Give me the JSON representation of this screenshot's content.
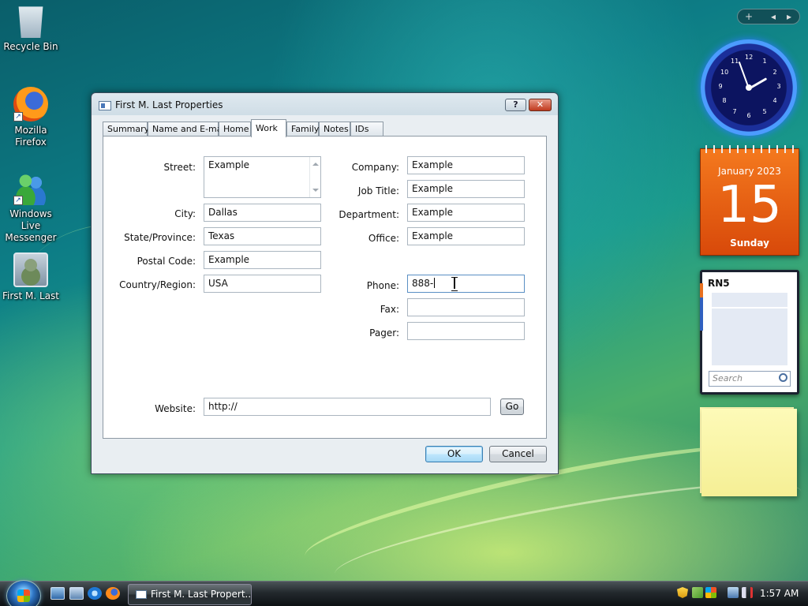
{
  "desktop": {
    "icons": [
      {
        "label": "Recycle Bin"
      },
      {
        "label": "Mozilla Firefox"
      },
      {
        "label": "Windows Live Messenger"
      },
      {
        "label": "First M. Last"
      }
    ]
  },
  "dialog": {
    "title": "First M. Last Properties",
    "help_label": "?",
    "close_label": "✕",
    "tabs": [
      {
        "label": "Summary"
      },
      {
        "label": "Name and E-mail"
      },
      {
        "label": "Home"
      },
      {
        "label": "Work",
        "active": true
      },
      {
        "label": "Family"
      },
      {
        "label": "Notes"
      },
      {
        "label": "IDs"
      }
    ],
    "fields": {
      "street": {
        "label": "Street:",
        "value": "Example"
      },
      "city": {
        "label": "City:",
        "value": "Dallas"
      },
      "state": {
        "label": "State/Province:",
        "value": "Texas"
      },
      "postal": {
        "label": "Postal Code:",
        "value": "Example"
      },
      "country": {
        "label": "Country/Region:",
        "value": "USA"
      },
      "company": {
        "label": "Company:",
        "value": "Example"
      },
      "job_title": {
        "label": "Job Title:",
        "value": "Example"
      },
      "department": {
        "label": "Department:",
        "value": "Example"
      },
      "office": {
        "label": "Office:",
        "value": "Example"
      },
      "phone": {
        "label": "Phone:",
        "value": "888-"
      },
      "fax": {
        "label": "Fax:",
        "value": ""
      },
      "pager": {
        "label": "Pager:",
        "value": ""
      },
      "website": {
        "label": "Website:",
        "value": "http://"
      }
    },
    "go_label": "Go",
    "ok_label": "OK",
    "cancel_label": "Cancel"
  },
  "sidebar": {
    "controls": {
      "add": "+",
      "prev": "◂",
      "next": "▸"
    },
    "clock": {
      "numbers": [
        "12",
        "1",
        "2",
        "3",
        "4",
        "5",
        "6",
        "7",
        "8",
        "9",
        "10",
        "11"
      ]
    },
    "calendar": {
      "month": "January 2023",
      "day": "15",
      "weekday": "Sunday"
    },
    "contacts": {
      "title": "RN5",
      "search_placeholder": "Search"
    }
  },
  "taskbar": {
    "window_button": "First M. Last Propert...",
    "time": "1:57 AM"
  },
  "colors": {
    "accent": "#3c7fb1",
    "calendar": "#e8651a",
    "close": "#c0391e"
  }
}
